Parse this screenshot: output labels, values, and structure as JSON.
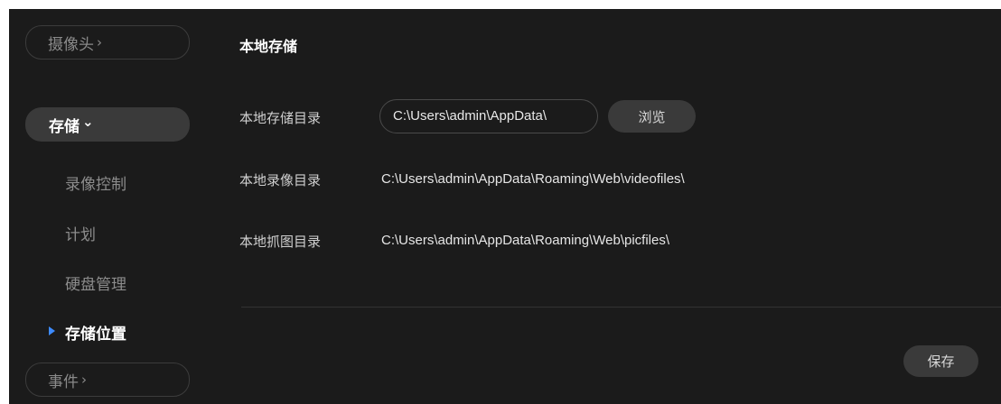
{
  "sidebar": {
    "camera": {
      "label": "摄像头",
      "chevron": "›"
    },
    "storage": {
      "label": "存储",
      "chevron": "⌄"
    },
    "items": [
      {
        "label": "录像控制"
      },
      {
        "label": "计划"
      },
      {
        "label": "硬盘管理"
      },
      {
        "label": "存储位置"
      }
    ],
    "events": {
      "label": "事件",
      "chevron": "›"
    },
    "active_marker_color": "#3d8bff"
  },
  "main": {
    "title": "本地存储",
    "storage_dir": {
      "label": "本地存储目录",
      "value": "C:\\Users\\admin\\AppData\\"
    },
    "browse_label": "浏览",
    "record_dir": {
      "label": "本地录像目录",
      "value": "C:\\Users\\admin\\AppData\\Roaming\\Web\\videofiles\\"
    },
    "snapshot_dir": {
      "label": "本地抓图目录",
      "value": "C:\\Users\\admin\\AppData\\Roaming\\Web\\picfiles\\"
    },
    "save_label": "保存"
  }
}
